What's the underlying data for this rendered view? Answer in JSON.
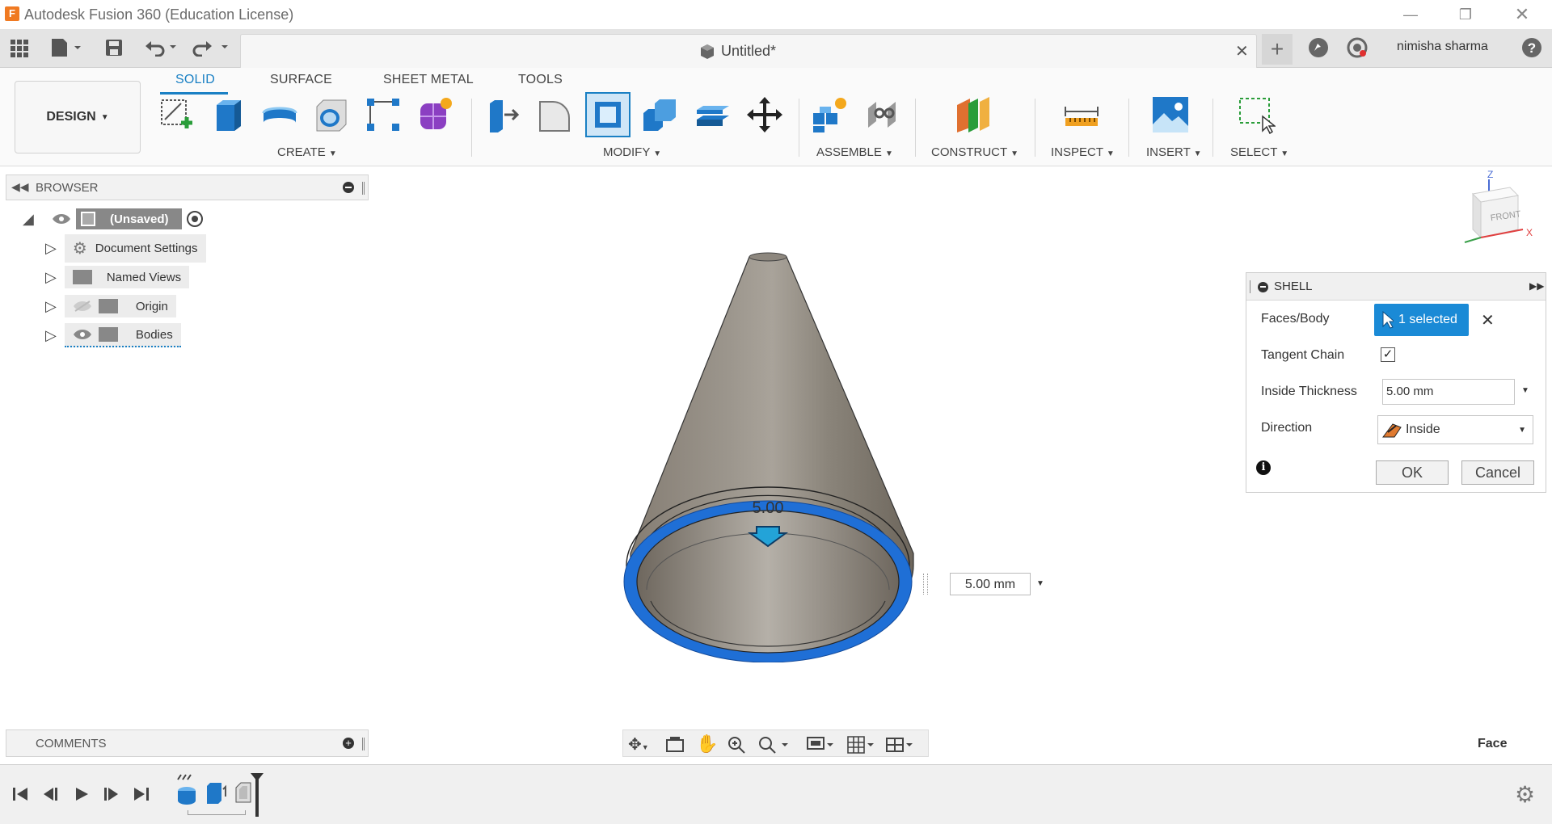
{
  "app": {
    "title": "Autodesk Fusion 360 (Education License)"
  },
  "document": {
    "title": "Untitled*"
  },
  "user": {
    "name": "nimisha sharma"
  },
  "ribbon": {
    "tabs": [
      "SOLID",
      "SURFACE",
      "SHEET METAL",
      "TOOLS"
    ],
    "active_tab": "SOLID",
    "workspace": "DESIGN",
    "groups": [
      "CREATE",
      "MODIFY",
      "ASSEMBLE",
      "CONSTRUCT",
      "INSPECT",
      "INSERT",
      "SELECT"
    ]
  },
  "browser": {
    "title": "BROWSER",
    "root": "(Unsaved)",
    "items": [
      "Document Settings",
      "Named Views",
      "Origin",
      "Bodies"
    ]
  },
  "shell": {
    "title": "SHELL",
    "faces_label": "Faces/Body",
    "faces_value": "1 selected",
    "tangent_label": "Tangent Chain",
    "tangent_checked": true,
    "thickness_label": "Inside Thickness",
    "thickness_value": "5.00 mm",
    "direction_label": "Direction",
    "direction_value": "Inside",
    "ok": "OK",
    "cancel": "Cancel"
  },
  "viewport": {
    "dimension_text": "5.00",
    "thickness_input": "5.00 mm",
    "viewcube_face": "FRONT",
    "selection_filter": "Face"
  },
  "comments": {
    "title": "COMMENTS"
  },
  "colors": {
    "accent": "#1a80c4",
    "selection_blue": "#1f6fd6",
    "body_gray": "#7d766c"
  }
}
